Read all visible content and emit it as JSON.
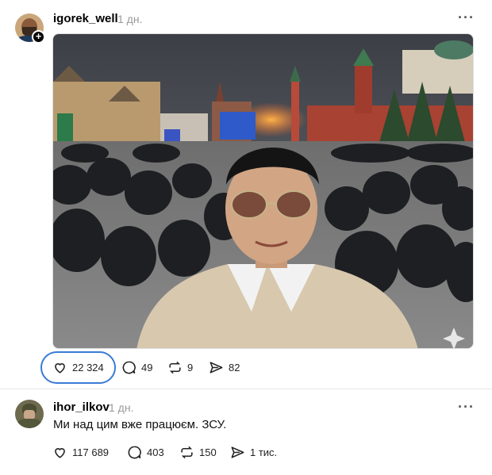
{
  "post": {
    "username": "igorek_well",
    "time": "1 дн.",
    "more_label": "···",
    "actions": {
      "likes": "22 324",
      "comments": "49",
      "reposts": "9",
      "shares": "82"
    }
  },
  "reply": {
    "username": "ihor_ilkov",
    "time": "1 дн.",
    "more_label": "···",
    "text": "Ми над цим вже працюєм. ЗСУ.",
    "actions": {
      "likes": "117 689",
      "comments": "403",
      "reposts": "150",
      "shares": "1 тис."
    }
  },
  "colors": {
    "highlight": "#3a7bd5",
    "timestamp": "#999999"
  }
}
